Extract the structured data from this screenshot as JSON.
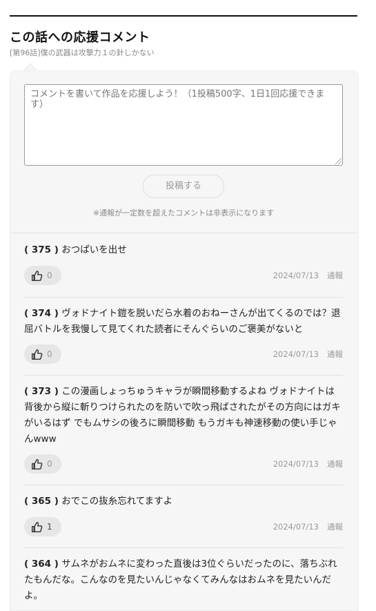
{
  "section": {
    "title": "この話への応援コメント",
    "episode": "[第96話]僕の武器は攻撃力１の針しかない"
  },
  "form": {
    "placeholder": "コメントを書いて作品を応援しよう！（1投稿500字、1日1回応援できます）",
    "submit_label": "投稿する",
    "notice": "※通報が一定数を超えたコメントは非表示になります"
  },
  "comments": [
    {
      "num": "( 375 )",
      "text": " おつぱいを出せ",
      "likes": "0",
      "date": "2024/07/13",
      "report": "通報"
    },
    {
      "num": "( 374 )",
      "text": " ヴォドナイト鎧を脱いだら水着のおねーさんが出てくるのでは？退屈バトルを我慢して見てくれた読者にそんぐらいのご褒美がないと",
      "likes": "0",
      "date": "2024/07/13",
      "report": "通報"
    },
    {
      "num": "( 373 )",
      "text": " この漫画しょっちゅうキャラが瞬間移動するよね ヴォドナイトは背後から縦に斬りつけられたのを防いで吹っ飛ばされたがその方向にはガキがいるはず でもムサシの後ろに瞬間移動 もうガキも神速移動の使い手じゃんwww",
      "likes": "0",
      "date": "2024/07/13",
      "report": "通報"
    },
    {
      "num": "( 365 )",
      "text": " おでこの抜糸忘れてますよ",
      "likes": "1",
      "date": "2024/07/13",
      "report": "通報"
    },
    {
      "num": "( 364 )",
      "text": " サムネがおムネに変わった直後は3位ぐらいだったのに、落ちぶれたもんだな。こんなのを見たいんじゃなくてみんなはおムネを見たいんだよ。",
      "likes": "",
      "date": "",
      "report": ""
    }
  ],
  "icons": {
    "like": "thumbs-up-icon"
  }
}
